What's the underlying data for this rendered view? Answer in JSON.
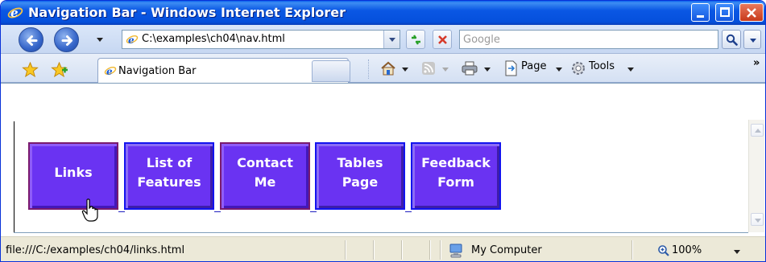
{
  "window": {
    "title": "Navigation Bar - Windows Internet Explorer",
    "controls": [
      "minimize-icon",
      "maximize-icon",
      "close-icon"
    ]
  },
  "navigation": {
    "address": "C:\\examples\\ch04\\nav.html",
    "search_placeholder": "Google",
    "icons": [
      "back-icon",
      "forward-icon",
      "refresh-icon",
      "stop-icon",
      "search-icon"
    ]
  },
  "toolbar": {
    "tab_title": "Navigation Bar",
    "page_label": "Page",
    "tools_label": "Tools",
    "chevron": "»"
  },
  "page": {
    "buttons": [
      {
        "label": "Links",
        "state": "hover"
      },
      {
        "label": "List of\nFeatures",
        "state": "normal"
      },
      {
        "label": "Contact\nMe",
        "state": "hover"
      },
      {
        "label": "Tables\nPage",
        "state": "normal"
      },
      {
        "label": "Feedback\nForm",
        "state": "normal"
      }
    ]
  },
  "status": {
    "url": "file:///C:/examples/ch04/links.html",
    "zone": "My Computer",
    "zoom": "100%"
  },
  "colors": {
    "button_fill": "#6a33f2",
    "button_border": "#1313ee",
    "button_border_hover": "#7a1a6e",
    "titlebar": "#0550dc"
  }
}
